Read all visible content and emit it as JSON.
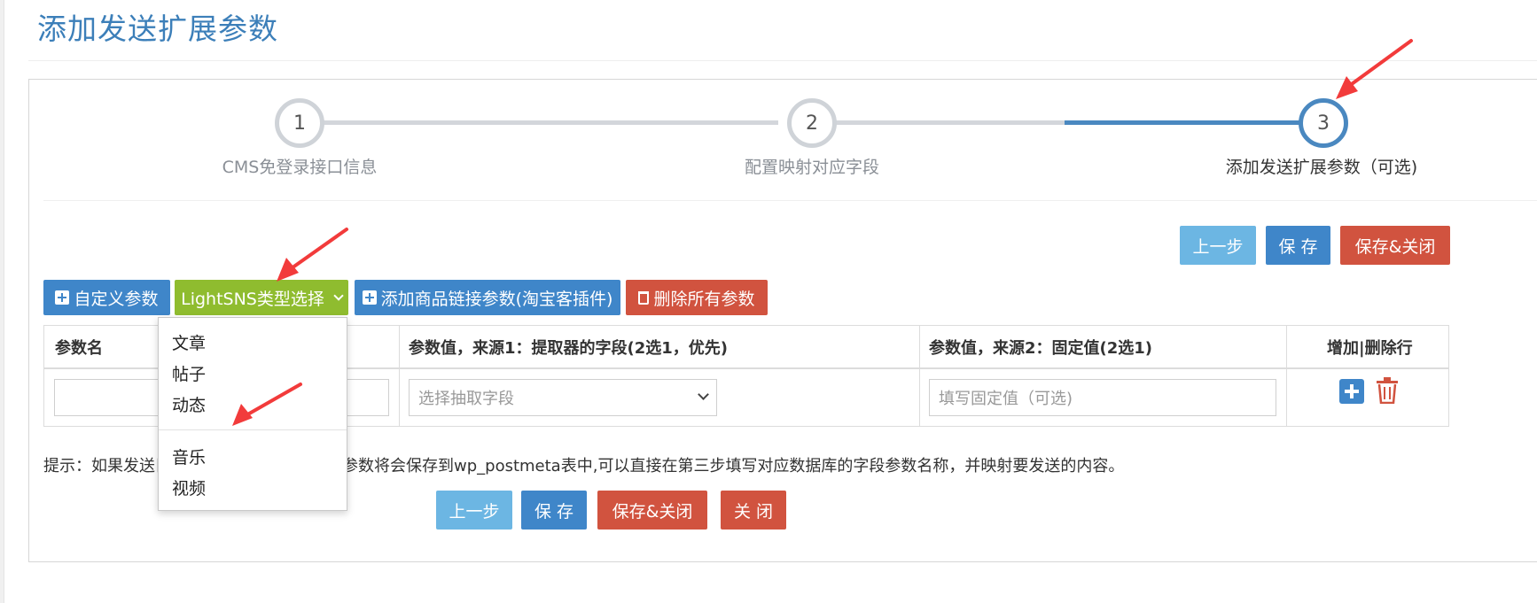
{
  "page": {
    "title": "添加发送扩展参数"
  },
  "wizard": {
    "steps": [
      {
        "number": "1",
        "label": "CMS免登录接口信息"
      },
      {
        "number": "2",
        "label": "配置映射对应字段"
      },
      {
        "number": "3",
        "label": "添加发送扩展参数（可选)"
      }
    ],
    "current_step": 3
  },
  "top_actions": {
    "prev": "上一步",
    "save": "保 存",
    "save_close": "保存&关闭"
  },
  "toolbar": {
    "custom_param": "自定义参数",
    "lightsns_select": "LightSNS类型选择",
    "add_product_link": "添加商品链接参数(淘宝客插件)",
    "delete_all": "删除所有参数"
  },
  "dropdown": {
    "items": [
      "文章",
      "帖子",
      "动态",
      "音乐",
      "视频"
    ]
  },
  "table": {
    "headers": [
      "参数名",
      "参数值，来源1：提取器的字段(2选1，优先)",
      "参数值，来源2：固定值(2选1)",
      "增加|删除行"
    ],
    "row": {
      "name_value": "",
      "source1_placeholder": "选择抽取字段",
      "source2_placeholder": "填写固定值（可选)"
    }
  },
  "hint": {
    "left": "提示：如果发送目",
    "right": "展参数将会保存到wp_postmeta表中,可以直接在第三步填写对应数据库的字段参数名称，并映射要发送的内容。"
  },
  "bottom_actions": {
    "prev": "上一步",
    "save": "保 存",
    "save_close": "保存&关闭",
    "close": "关 闭"
  },
  "colors": {
    "primary": "#3f86c9",
    "light": "#6cb6e3",
    "danger": "#d1533f",
    "success": "#8fbc2f",
    "title": "#3c7fb9",
    "annotation_arrow": "#f23b3b"
  }
}
